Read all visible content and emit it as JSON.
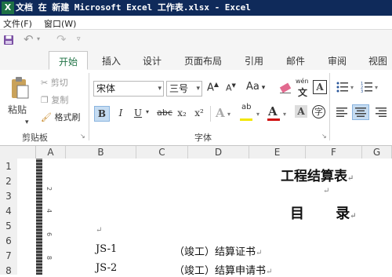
{
  "titlebar": {
    "app_icon": "X",
    "title": "文档 在 新建 Microsoft Excel 工作表.xlsx - Excel"
  },
  "menubar": {
    "items": [
      "文件(F)",
      "窗口(W)"
    ]
  },
  "qat": {
    "save_icon": "save-icon",
    "undo_icon": "undo-icon",
    "redo_icon": "redo-icon"
  },
  "tabs": [
    {
      "label": "开始",
      "active": true
    },
    {
      "label": "插入"
    },
    {
      "label": "设计"
    },
    {
      "label": "页面布局"
    },
    {
      "label": "引用"
    },
    {
      "label": "邮件"
    },
    {
      "label": "审阅"
    },
    {
      "label": "视图"
    }
  ],
  "ribbon": {
    "clipboard": {
      "paste": "粘贴",
      "cut": "剪切",
      "copy": "复制",
      "format_painter": "格式刷",
      "label": "剪贴板"
    },
    "font": {
      "name": "宋体",
      "size": "三号",
      "aa": "Aa",
      "label": "字体",
      "wen": "wén",
      "a_box": "A"
    },
    "format_buttons": {
      "bold": "B",
      "italic": "I",
      "underline": "U",
      "strike": "abc",
      "sub": "x₂",
      "sup": "x²"
    },
    "font_color": "#d01010",
    "highlight_color": "#f2e600"
  },
  "columns": [
    "A",
    "B",
    "C",
    "D",
    "E",
    "F",
    "G"
  ],
  "rows": [
    "1",
    "2",
    "3",
    "4",
    "5",
    "6",
    "7",
    "8"
  ],
  "ruler_marks": [
    "2",
    "4",
    "6",
    "8"
  ],
  "document": {
    "title": "工程结算表",
    "toc": "目 录",
    "pilcrow": "↵",
    "items": [
      {
        "code": "JS-1",
        "name": "（竣工）结算证书"
      },
      {
        "code": "JS-2",
        "name": "（竣工）结算申请书"
      }
    ]
  }
}
